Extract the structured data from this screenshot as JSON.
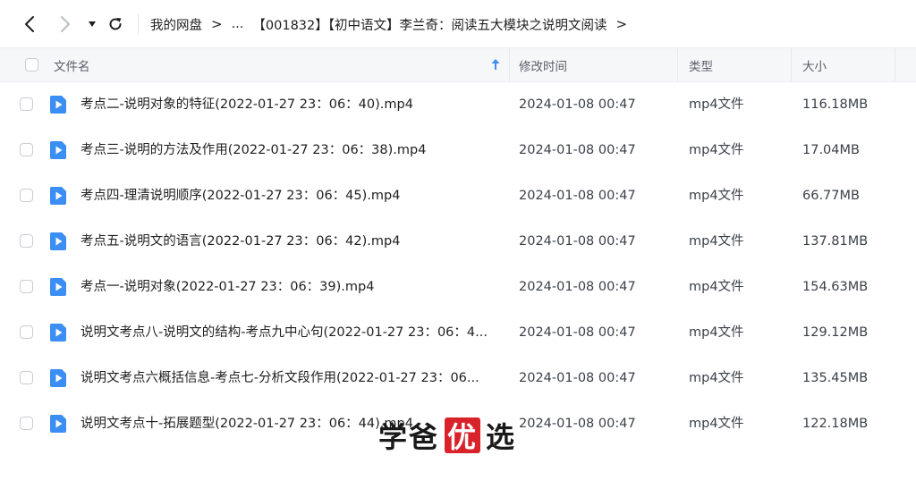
{
  "navbar": {
    "breadcrumb": [
      "我的网盘",
      "...",
      "【001832】【初中语文】李兰奇：阅读五大模块之说明文阅读"
    ],
    "separator": ">"
  },
  "columns": {
    "name": "文件名",
    "modified": "修改时间",
    "type": "类型",
    "size": "大小"
  },
  "files": [
    {
      "name": "考点二-说明对象的特征(2022-01-27 23：06：40).mp4",
      "modified": "2024-01-08 00:47",
      "type": "mp4文件",
      "size": "116.18MB"
    },
    {
      "name": "考点三-说明的方法及作用(2022-01-27 23：06：38).mp4",
      "modified": "2024-01-08 00:47",
      "type": "mp4文件",
      "size": "17.04MB"
    },
    {
      "name": "考点四-理清说明顺序(2022-01-27 23：06：45).mp4",
      "modified": "2024-01-08 00:47",
      "type": "mp4文件",
      "size": "66.77MB"
    },
    {
      "name": "考点五-说明文的语言(2022-01-27 23：06：42).mp4",
      "modified": "2024-01-08 00:47",
      "type": "mp4文件",
      "size": "137.81MB"
    },
    {
      "name": "考点一-说明对象(2022-01-27 23：06：39).mp4",
      "modified": "2024-01-08 00:47",
      "type": "mp4文件",
      "size": "154.63MB"
    },
    {
      "name": "说明文考点八-说明文的结构-考点九中心句(2022-01-27 23：06：4...",
      "modified": "2024-01-08 00:47",
      "type": "mp4文件",
      "size": "129.12MB"
    },
    {
      "name": "说明文考点六概括信息-考点七-分析文段作用(2022-01-27 23：06...",
      "modified": "2024-01-08 00:47",
      "type": "mp4文件",
      "size": "135.45MB"
    },
    {
      "name": "说明文考点十-拓展题型(2022-01-27 23：06：44).mp4",
      "modified": "2024-01-08 00:47",
      "type": "mp4文件",
      "size": "122.18MB"
    }
  ],
  "watermark": {
    "left": "学爸",
    "badge": "优",
    "right": "选"
  },
  "colors": {
    "file_icon": "#3b8ef3",
    "watermark_badge": "#d8232a",
    "sort_arrow": "#3b8ef3"
  },
  "icons": {
    "back": "chevron-left-icon",
    "forward": "chevron-right-icon",
    "history": "caret-down-icon",
    "refresh": "refresh-icon",
    "sort": "arrow-up-icon",
    "file": "video-file-icon"
  }
}
